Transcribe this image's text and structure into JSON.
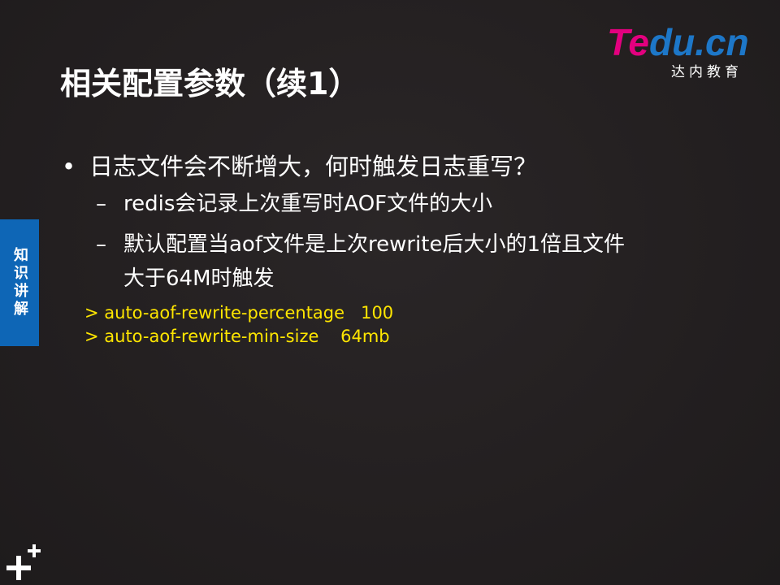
{
  "logo": {
    "text_te": "Te",
    "text_du": "du.cn",
    "subtitle": "达内教育",
    "colors": {
      "te": "#e3007f",
      "du": "#1d77c8"
    }
  },
  "title": "相关配置参数（续1）",
  "side_tab": {
    "label": "知识讲解",
    "color": "#0e66b6"
  },
  "bullet": {
    "marker": "•",
    "text": "日志文件会不断增大，何时触发日志重写？"
  },
  "sub_items": [
    {
      "marker": "–",
      "text": "redis会记录上次重写时AOF文件的大小"
    },
    {
      "marker": "–",
      "text": "默认配置当aof文件是上次rewrite后大小的1倍且文件",
      "continuation": "大于64M时触发"
    }
  ],
  "code_lines": [
    "> auto-aof-rewrite-percentage   100",
    "> auto-aof-rewrite-min-size    64mb"
  ],
  "code_color": "#ffe600",
  "corner_icon": "plus-plus-icon"
}
